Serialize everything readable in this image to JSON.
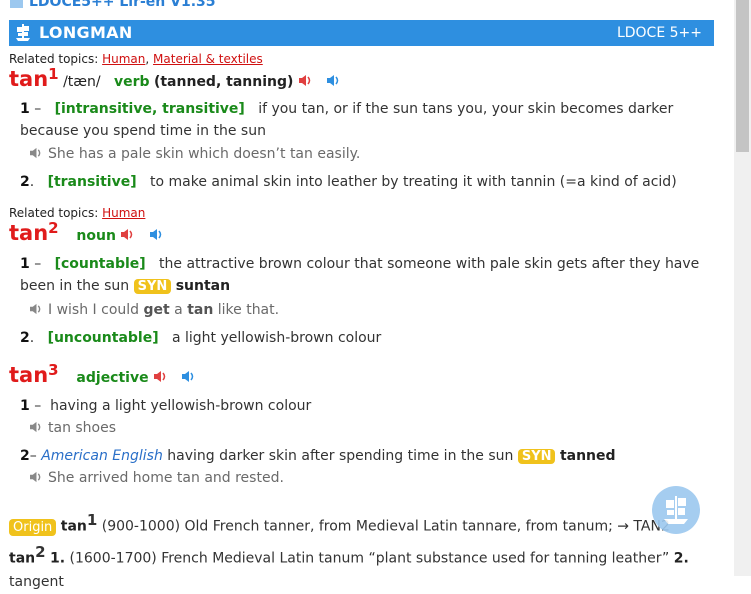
{
  "window": {
    "title_partial": "LDOCE5++ Lir-en V1.35"
  },
  "header": {
    "brand": "LONGMAN",
    "edition": "LDOCE 5++"
  },
  "entries": [
    {
      "related_label": "Related topics:",
      "topics": [
        "Human",
        "Material & textiles"
      ],
      "headword": "tan",
      "homograph": "1",
      "pron": "/tæn/",
      "pos": "verb",
      "inflections": "(tanned, tanning)",
      "senses": [
        {
          "num": "1",
          "sep": "–",
          "gram": "[intransitive, transitive]",
          "def": "if you tan, or if the sun tans you, your skin becomes darker because you spend time in the sun",
          "example": "She has a pale skin which doesn’t tan easily."
        },
        {
          "num": "2",
          "sep": ".",
          "gram": "[transitive]",
          "def": "to make animal skin into leather by treating it with tannin (=a kind of acid)"
        }
      ]
    },
    {
      "related_label": "Related topics:",
      "topics": [
        "Human"
      ],
      "headword": "tan",
      "homograph": "2",
      "pos": "noun",
      "senses": [
        {
          "num": "1",
          "sep": "–",
          "gram": "[countable]",
          "def": "the attractive brown colour that someone with pale skin gets after they have been in the sun",
          "syn_label": "SYN",
          "syn_word": "suntan",
          "example_parts": [
            "I wish I could ",
            "get",
            " a ",
            "tan",
            " like that."
          ]
        },
        {
          "num": "2",
          "sep": ".",
          "gram": "[uncountable]",
          "def": "a light yellowish-brown colour"
        }
      ]
    },
    {
      "headword": "tan",
      "homograph": "3",
      "pos": "adjective",
      "senses": [
        {
          "num": "1",
          "sep": "–",
          "def": "having a light yellowish-brown colour",
          "example": "tan shoes"
        },
        {
          "num": "2",
          "sep": "–",
          "geo": "American English",
          "def": "having darker skin after spending time in the sun",
          "syn_label": "SYN",
          "syn_word": "tanned",
          "example": "She arrived home tan and rested."
        }
      ]
    }
  ],
  "origin": {
    "badge": "Origin",
    "word": "tan",
    "sup": "1",
    "text1": "(900-1000) Old French tanner, from Medieval Latin tannare, from tanum; → TAN2",
    "word2": "tan",
    "sup2": "2",
    "n1": "1.",
    "text2": "(1600-1700) French Medieval Latin tanum “plant substance used for tanning leather”",
    "n2": "2.",
    "text3": "tangent"
  },
  "colors": {
    "header_bg": "#2e8fe0",
    "headword": "#e01b1b",
    "pos": "#1a8a1a",
    "syn_badge": "#f0c21c",
    "link_red": "#d01010",
    "geo_blue": "#2a6fc8"
  },
  "icons": {
    "uk_audio": "speaker-red-icon",
    "us_audio": "speaker-blue-icon",
    "example_audio": "speaker-gray-icon",
    "logo": "ship-logo-icon",
    "floating": "float-button-icon"
  }
}
